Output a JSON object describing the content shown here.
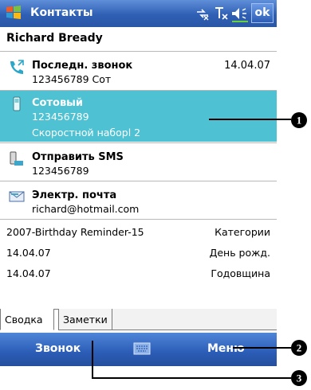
{
  "titlebar": {
    "title": "Контакты",
    "ok_label": "ok"
  },
  "contact": {
    "name": "Richard Bready"
  },
  "entries": [
    {
      "label": "Последн. звонок",
      "value": "123456789 Сот",
      "date": "14.04.07"
    },
    {
      "label": "Сотовый",
      "value": "123456789",
      "extra": "Скоростной наборl 2"
    },
    {
      "label": "Отправить SMS",
      "value": "123456789"
    },
    {
      "label": "Электр. почта",
      "value": "richard@hotmail.com"
    }
  ],
  "info_rows": [
    {
      "left": "2007-Birthday Reminder-15",
      "right": "Категории"
    },
    {
      "left": "14.04.07",
      "right": "День рожд."
    },
    {
      "left": "14.04.07",
      "right": "Годовщина"
    }
  ],
  "tabs": [
    {
      "label": "Сводка"
    },
    {
      "label": "Заметки"
    }
  ],
  "menubar": {
    "left": "Звонок",
    "right": "Меню"
  },
  "callouts": [
    {
      "num": "1"
    },
    {
      "num": "2"
    },
    {
      "num": "3"
    }
  ],
  "colors": {
    "titlebar": "#2f5fb4",
    "selection": "#4ec1d2",
    "menubar": "#2b5cb6"
  },
  "icons": [
    "windows-start-icon",
    "connectivity-icon",
    "signal-icon",
    "speaker-icon",
    "phone-call-icon",
    "mobile-phone-icon",
    "sms-icon",
    "email-icon",
    "keyboard-icon"
  ]
}
